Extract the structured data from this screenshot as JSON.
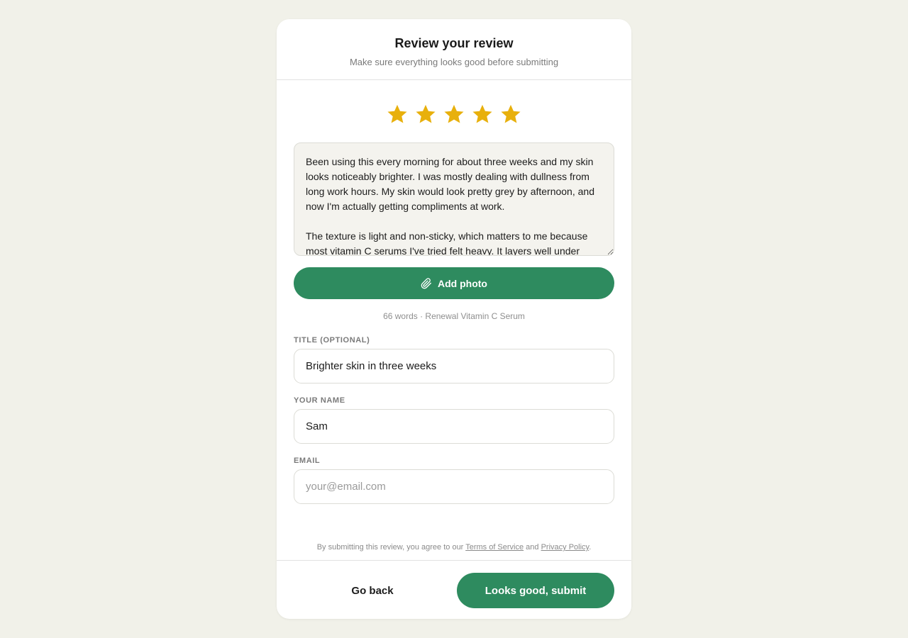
{
  "header": {
    "title": "Review your review",
    "subtitle": "Make sure everything looks good before submitting"
  },
  "rating": {
    "value": 5,
    "max": 5,
    "star_color": "#e8b00c",
    "icon": "star-icon"
  },
  "review": {
    "text": "Been using this every morning for about three weeks and my skin looks noticeably brighter. I was mostly dealing with dullness from long work hours. My skin would look pretty grey by afternoon, and now I'm actually getting compliments at work.\n\nThe texture is light and non-sticky, which matters to me because most vitamin C serums I've tried felt heavy. It layers well under"
  },
  "add_photo": {
    "label": "Add photo",
    "icon": "paperclip-icon",
    "color": "#2e8b5f"
  },
  "meta": {
    "text": "66 words · Renewal Vitamin C Serum"
  },
  "fields": {
    "title": {
      "label": "TITLE (OPTIONAL)",
      "value": "Brighter skin in three weeks"
    },
    "name": {
      "label": "YOUR NAME",
      "value": "Sam"
    },
    "email": {
      "label": "EMAIL",
      "value": "",
      "placeholder": "your@email.com"
    }
  },
  "legal": {
    "prefix": "By submitting this review, you agree to our ",
    "terms": "Terms of Service",
    "middle": " and ",
    "privacy": "Privacy Policy",
    "suffix": "."
  },
  "footer": {
    "back_label": "Go back",
    "submit_label": "Looks good, submit",
    "accent": "#2e8b5f"
  }
}
